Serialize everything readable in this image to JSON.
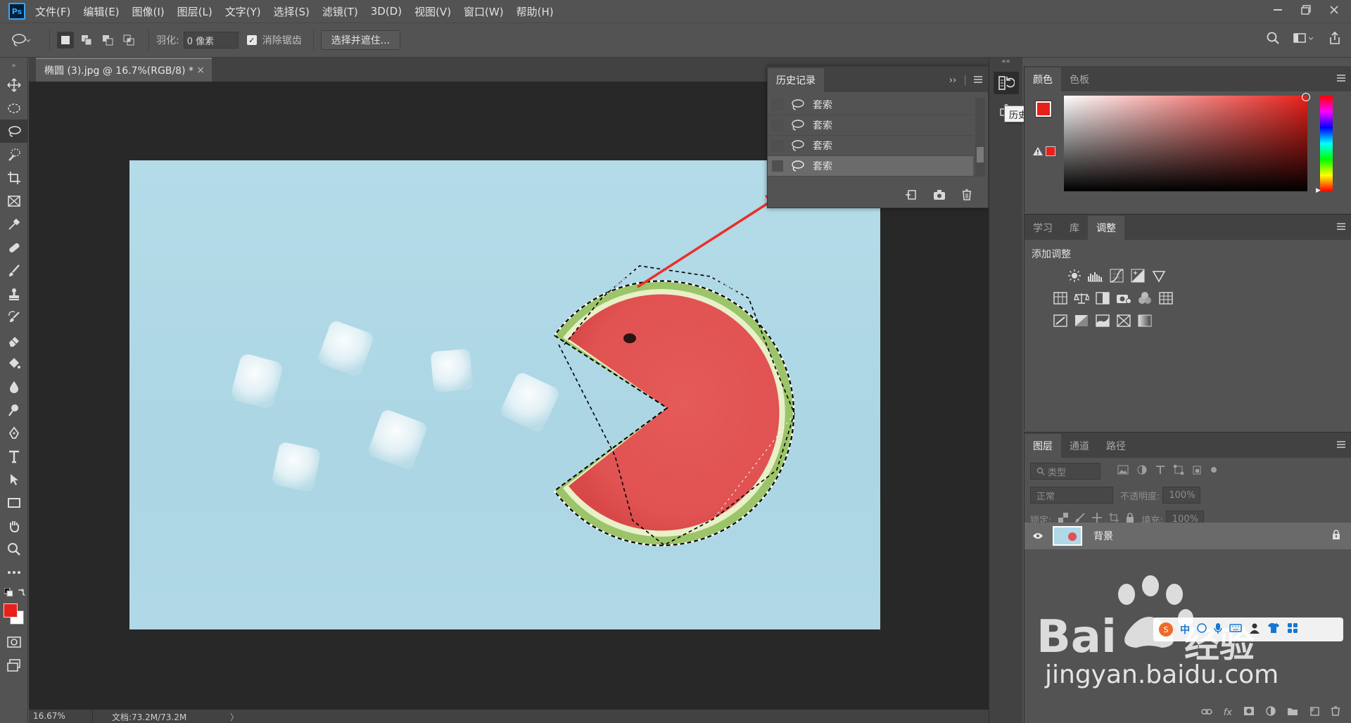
{
  "app": {
    "logo": "Ps",
    "menu": [
      "文件(F)",
      "编辑(E)",
      "图像(I)",
      "图层(L)",
      "文字(Y)",
      "选择(S)",
      "滤镜(T)",
      "3D(D)",
      "视图(V)",
      "窗口(W)",
      "帮助(H)"
    ]
  },
  "options": {
    "feather_label": "羽化:",
    "feather_value": "0 像素",
    "antialias_label": "消除锯齿",
    "select_mask_button": "选择并遮住..."
  },
  "document": {
    "tab_title": "椭圆 (3).jpg @ 16.7%(RGB/8) *",
    "close": "×",
    "zoom": "16.67%",
    "doc_info": "文档:73.2M/73.2M",
    "status_arrow": "〉"
  },
  "history": {
    "tab_label": "历史记录",
    "items": [
      "套索",
      "套索",
      "套索",
      "套索"
    ],
    "selected_index": 3,
    "tooltip": "历史记录"
  },
  "color_panel": {
    "tabs": [
      "颜色",
      "色板"
    ],
    "foreground": "#e8201a"
  },
  "adjust_panel": {
    "tabs": [
      "学习",
      "库",
      "调整"
    ],
    "title": "添加调整"
  },
  "layers_panel": {
    "tabs": [
      "图层",
      "通道",
      "路径"
    ],
    "filter_placeholder": "类型",
    "blend_mode": "正常",
    "opacity_label": "不透明度:",
    "opacity_value": "100%",
    "lock_label": "锁定:",
    "fill_label": "填充:",
    "fill_value": "100%",
    "layer_name": "背景"
  },
  "watermark": {
    "brand_left": "Bai",
    "brand_right": "经验",
    "url": "jingyan.baidu.com",
    "badge": "中"
  }
}
